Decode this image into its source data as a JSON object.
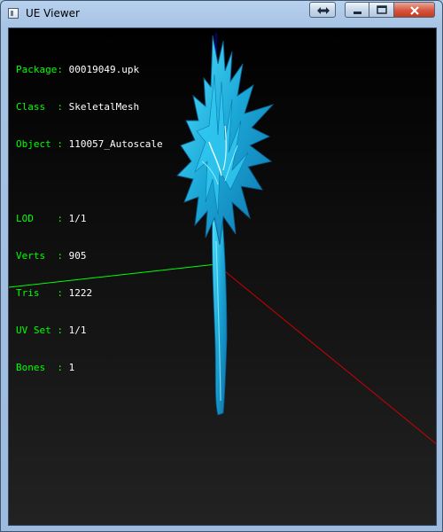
{
  "window": {
    "title": "UE Viewer",
    "buttons": {
      "resize_icon": "resize-arrows-icon",
      "minimize_icon": "minimize-icon",
      "maximize_icon": "maximize-icon",
      "close_icon": "close-icon"
    }
  },
  "info": {
    "package": {
      "label": "Package",
      "value": "00019049.upk"
    },
    "class": {
      "label": "Class  ",
      "value": "SkeletalMesh"
    },
    "object": {
      "label": "Object ",
      "value": "110057_Autoscale"
    },
    "lod": {
      "label": "LOD    ",
      "value": "1/1"
    },
    "verts": {
      "label": "Verts  ",
      "value": "905"
    },
    "tris": {
      "label": "Tris   ",
      "value": "1222"
    },
    "uvset": {
      "label": "UV Set ",
      "value": "1/1"
    },
    "bones": {
      "label": "Bones  ",
      "value": "1"
    },
    "separator": ": "
  },
  "colors": {
    "label_green": "#00ff00",
    "axis_x_red": "#ff0000",
    "axis_y_green": "#00ff00",
    "axis_z_blue": "#0000ff",
    "mesh_cyan": "#19b8e8"
  }
}
